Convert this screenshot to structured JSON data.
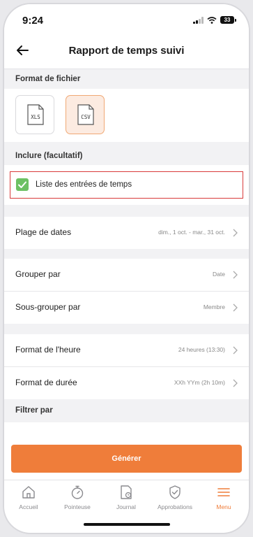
{
  "status": {
    "time": "9:24",
    "battery": "33"
  },
  "header": {
    "title": "Rapport de temps suivi"
  },
  "format": {
    "heading": "Format de fichier",
    "options": [
      {
        "label": "XLS",
        "selected": false
      },
      {
        "label": "CSV",
        "selected": true
      }
    ]
  },
  "include": {
    "heading": "Inclure (facultatif)",
    "option_label": "Liste des entrées de temps",
    "checked": true
  },
  "rows": {
    "date_range": {
      "label": "Plage de dates",
      "value": "dim., 1 oct. - mar., 31 oct."
    },
    "group_by": {
      "label": "Grouper par",
      "value": "Date"
    },
    "subgroup_by": {
      "label": "Sous-grouper par",
      "value": "Membre"
    },
    "time_format": {
      "label": "Format de l'heure",
      "value": "24 heures (13:30)"
    },
    "duration_format": {
      "label": "Format de durée",
      "value": "XXh YYm (2h 10m)"
    }
  },
  "filter": {
    "heading": "Filtrer par"
  },
  "actions": {
    "generate_label": "Générer"
  },
  "tabs": [
    {
      "label": "Accueil",
      "icon": "home-icon"
    },
    {
      "label": "Pointeuse",
      "icon": "stopwatch-icon"
    },
    {
      "label": "Journal",
      "icon": "timesheet-icon"
    },
    {
      "label": "Approbations",
      "icon": "shield-check-icon"
    },
    {
      "label": "Menu",
      "icon": "menu-icon",
      "active": true
    }
  ],
  "colors": {
    "accent": "#ef7d3a",
    "check": "#6cc063",
    "highlight": "#d93a3a"
  }
}
